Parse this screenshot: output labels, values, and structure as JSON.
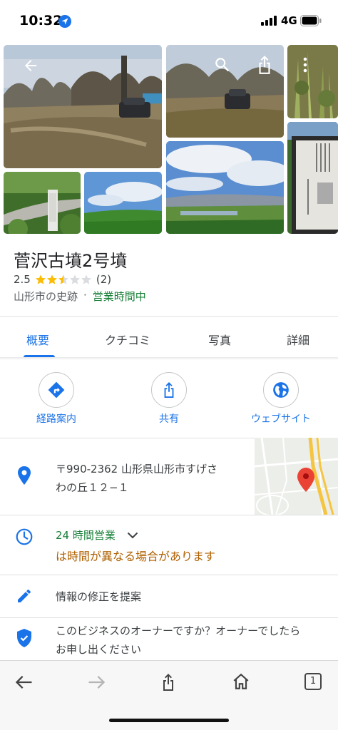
{
  "status_bar": {
    "time": "10:32",
    "network": "4G"
  },
  "place": {
    "title": "菅沢古墳2号墳",
    "rating": "2.5",
    "rating_value": 2.5,
    "review_count": "(2)",
    "category": "山形市の史跡",
    "separator": "·",
    "open_status": "営業時間中"
  },
  "tabs": [
    {
      "label": "概要",
      "active": true
    },
    {
      "label": "クチコミ",
      "active": false
    },
    {
      "label": "写真",
      "active": false
    },
    {
      "label": "詳細",
      "active": false
    }
  ],
  "actions": [
    {
      "label": "経路案内",
      "icon": "directions-icon"
    },
    {
      "label": "共有",
      "icon": "share-icon"
    },
    {
      "label": "ウェブサイト",
      "icon": "globe-icon"
    }
  ],
  "address": {
    "line1": "〒990-2362 山形県山形市すげさ",
    "line2": "わの丘１２−１"
  },
  "hours": {
    "main": "24 時間営業",
    "warning": "は時間が異なる場合があります"
  },
  "suggest_edit": "情報の修正を提案",
  "owner": {
    "line1": "このビジネスのオーナーですか？オーナーでしたら",
    "line2": "お申し出ください"
  },
  "toolbar": {
    "tab_count": "1"
  },
  "colors": {
    "accent": "#1a73e8",
    "open": "#188038",
    "warning": "#b06000",
    "star": "#fbbc04",
    "pin": "#ea4335"
  }
}
